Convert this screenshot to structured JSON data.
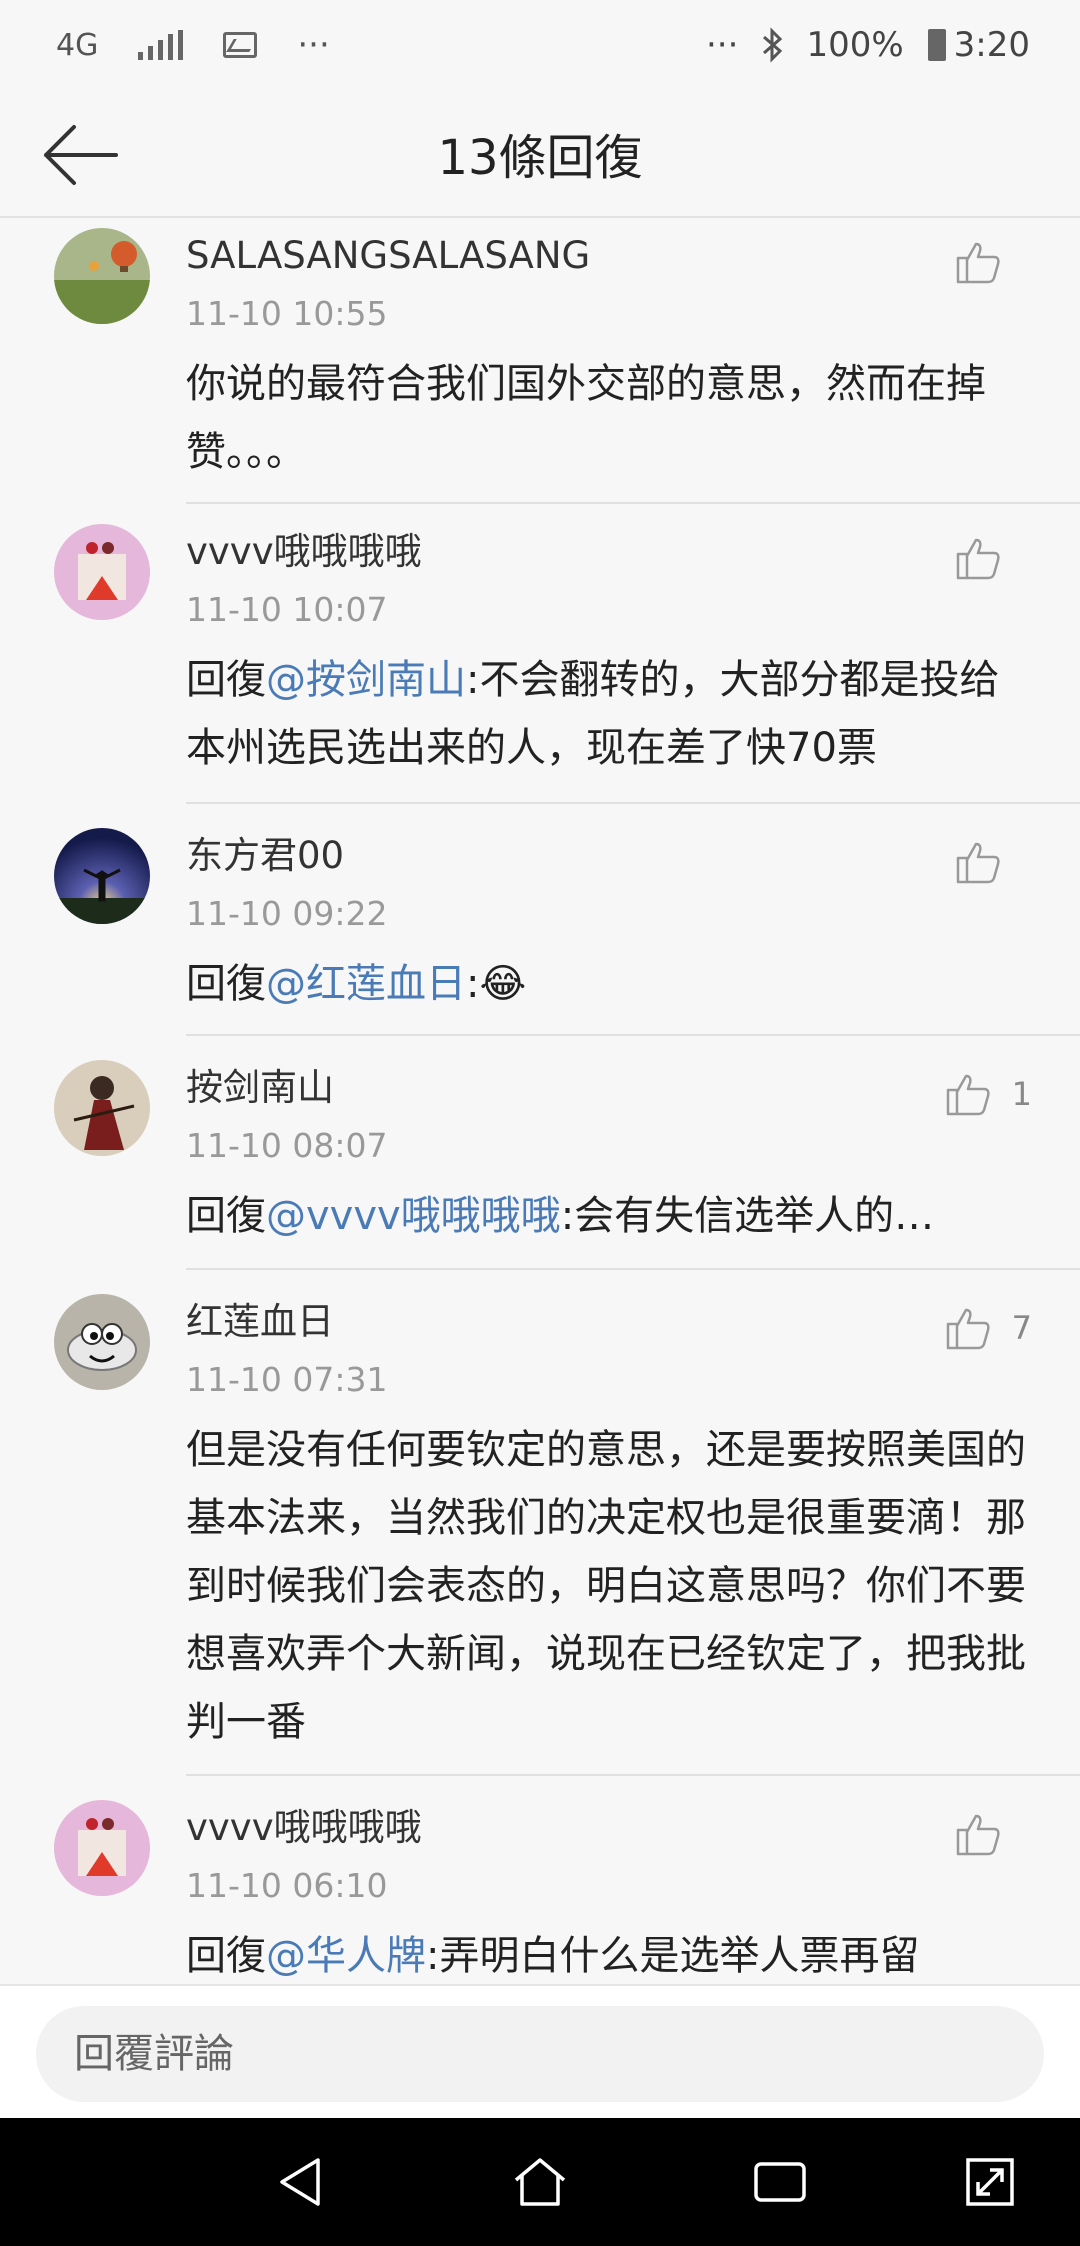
{
  "status_bar": {
    "network": "4G",
    "more": "···",
    "more_right": "···",
    "battery": "100%",
    "time": "3:20"
  },
  "header": {
    "title": "13條回復"
  },
  "comments": [
    {
      "user": "SALASANGSALASANG",
      "time": "11-10 10:55",
      "text": "你说的最符合我们国外交部的意思，然而在掉赞。。。",
      "likes": ""
    },
    {
      "user": "vvvv哦哦哦哦",
      "time": "11-10 10:07",
      "prefix": "回復",
      "mention": "@按剑南山",
      "text": ":不会翻转的，大部分都是投给本州选民选出来的人，现在差了快70票",
      "likes": ""
    },
    {
      "user": "东方君00",
      "time": "11-10 09:22",
      "prefix": "回復",
      "mention": "@红莲血日",
      "text": ":",
      "emoji": "😂",
      "likes": ""
    },
    {
      "user": "按剑南山",
      "time": "11-10 08:07",
      "prefix": "回復",
      "mention": "@vvvv哦哦哦哦",
      "text": ":会有失信选举人的…",
      "likes": "1"
    },
    {
      "user": "红莲血日",
      "time": "11-10 07:31",
      "text": "但是没有任何要钦定的意思，还是要按照美国的基本法来，当然我们的决定权也是很重要滴！那到时候我们会表态的，明白这意思吗？你们不要想喜欢弄个大新闻，说现在已经钦定了，把我批判一番",
      "likes": "7"
    },
    {
      "user": "vvvv哦哦哦哦",
      "time": "11-10 06:10",
      "prefix": "回復",
      "mention": "@华人牌",
      "text": ":弄明白什么是选举人票再留",
      "likes": ""
    }
  ],
  "reply": {
    "placeholder": "回覆評論"
  }
}
